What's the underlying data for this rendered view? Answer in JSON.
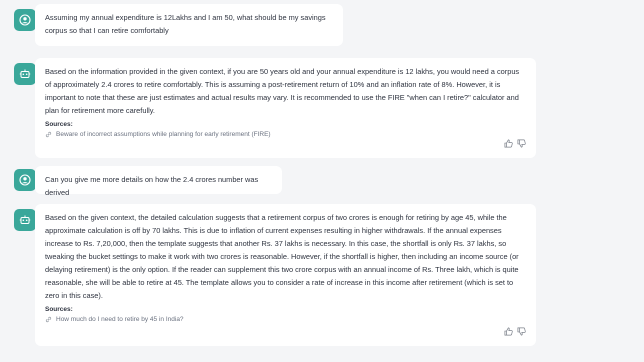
{
  "conversation": [
    {
      "role": "user",
      "icon": "user-icon",
      "text": "Assuming my annual expenditure is 12Lakhs and I am 50, what should be my savings corpus so that I can retire comfortably"
    },
    {
      "role": "assistant",
      "icon": "bot-icon",
      "text": "Based on the information provided in the given context, if you are 50 years old and your annual expenditure is 12 lakhs, you would need a corpus of approximately 2.4 crores to retire comfortably. This is assuming a post-retirement return of 10% and an inflation rate of 8%. However, it is important to note that these are just estimates and actual results may vary. It is recommended to use the FIRE \"when can I retire?\" calculator and plan for retirement more carefully.",
      "sources_label": "Sources:",
      "sources": [
        "Beware of incorrect assumptions while planning for early retirement (FIRE)"
      ]
    },
    {
      "role": "user",
      "icon": "user-icon",
      "text": "Can you give me more details on how the 2.4 crores number was derived"
    },
    {
      "role": "assistant",
      "icon": "bot-icon",
      "text": "Based on the given context, the detailed calculation suggests that a retirement corpus of two crores is enough for retiring by age 45, while the approximate calculation is off by 70 lakhs. This is due to inflation of current expenses resulting in higher withdrawals. If the annual expenses increase to Rs. 7,20,000, then the template suggests that another Rs. 37 lakhs is necessary. In this case, the shortfall is only Rs. 37 lakhs, so tweaking the bucket settings to make it work with two crores is reasonable. However, if the shortfall is higher, then including an income source (or delaying retirement) is the only option. If the reader can supplement this two crore corpus with an annual income of Rs. Three lakh, which is quite reasonable, she will be able to retire at 45. The template allows you to consider a rate of increase in this income after retirement (which is set to zero in this case).",
      "sources_label": "Sources:",
      "sources": [
        "How much do I need to retire by 45 in India?"
      ]
    }
  ],
  "colors": {
    "background": "#f4f5f7",
    "bubble": "#ffffff",
    "avatar": "#3aa79a",
    "text": "#2f3440",
    "muted": "#6b7280"
  }
}
